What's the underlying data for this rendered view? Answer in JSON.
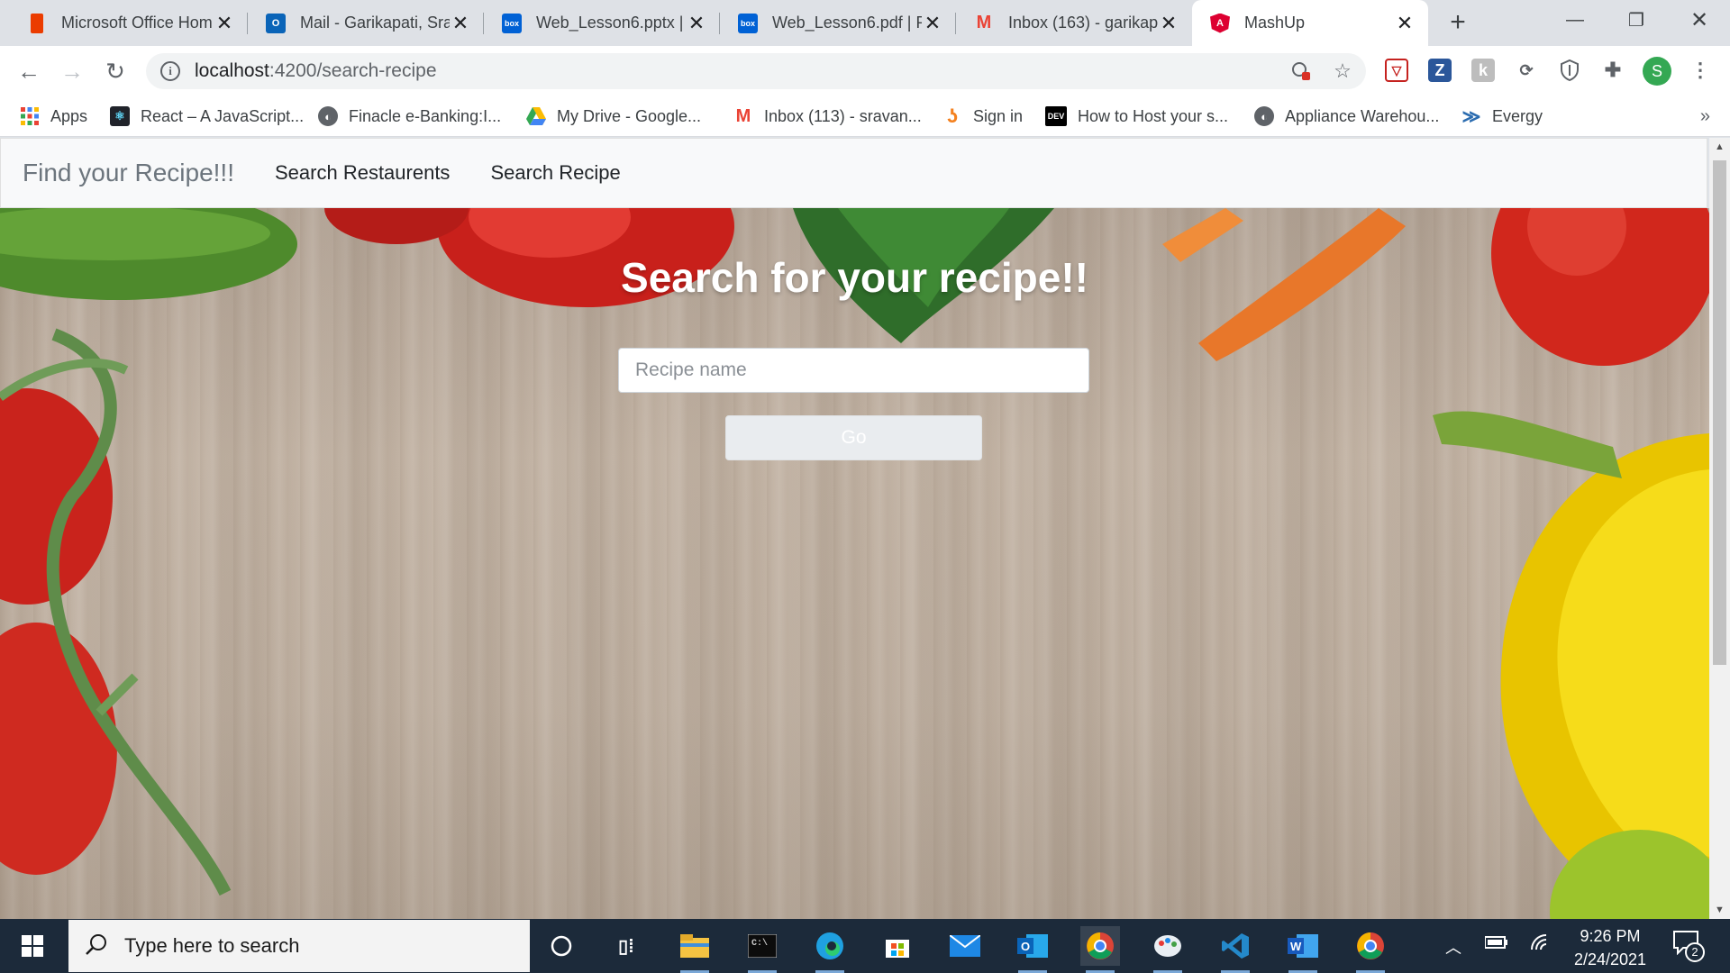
{
  "browser": {
    "tabs": [
      {
        "title": "Microsoft Office Hom",
        "icon": "office-icon"
      },
      {
        "title": "Mail - Garikapati, Sra",
        "icon": "outlook-icon"
      },
      {
        "title": "Web_Lesson6.pptx | P",
        "icon": "box-icon"
      },
      {
        "title": "Web_Lesson6.pdf | Pc",
        "icon": "box-icon"
      },
      {
        "title": "Inbox (163) - garikap",
        "icon": "gmail-icon"
      },
      {
        "title": "MashUp",
        "icon": "angular-icon",
        "active": true
      }
    ],
    "box_label": "box",
    "new_tab": "+",
    "address": {
      "host": "localhost",
      "path": ":4200/search-recipe"
    },
    "profile_initial": "S",
    "bookmarks": [
      {
        "label": "Apps",
        "icon": "apps-grid-icon"
      },
      {
        "label": "React – A JavaScript...",
        "icon": "react-icon"
      },
      {
        "label": "Finacle e-Banking:I...",
        "icon": "globe-icon"
      },
      {
        "label": "My Drive - Google...",
        "icon": "google-drive-icon"
      },
      {
        "label": "Inbox (113) - sravan...",
        "icon": "gmail-icon"
      },
      {
        "label": "Sign in",
        "icon": "sign-in-icon"
      },
      {
        "label": "How to Host your s...",
        "icon": "dev-icon",
        "badge": "DEV"
      },
      {
        "label": "Appliance Warehou...",
        "icon": "globe-icon"
      },
      {
        "label": "Evergy",
        "icon": "evergy-icon"
      }
    ],
    "more_bookmarks": "»"
  },
  "app": {
    "brand": "Find your Recipe!!!",
    "nav": [
      "Search Restaurents",
      "Search Recipe"
    ],
    "hero_title": "Search for your recipe!!",
    "search_placeholder": "Recipe name",
    "go_label": "Go"
  },
  "taskbar": {
    "search_placeholder": "Type here to search",
    "time": "9:26 PM",
    "date": "2/24/2021",
    "notification_count": "2",
    "apps": [
      "cortana-icon",
      "task-view-icon",
      "file-explorer-icon",
      "terminal-icon",
      "edge-icon",
      "store-icon",
      "mail-icon",
      "outlook-icon",
      "chrome-icon",
      "paint-icon",
      "vscode-icon",
      "word-icon",
      "chrome-icon"
    ]
  },
  "colors": {
    "nav_bg": "#f8f9fa",
    "brand_text": "#6c757d",
    "hero_title": "#ffffff",
    "button_bg": "#e9ecef",
    "taskbar_bg": "#1c2a3a"
  }
}
